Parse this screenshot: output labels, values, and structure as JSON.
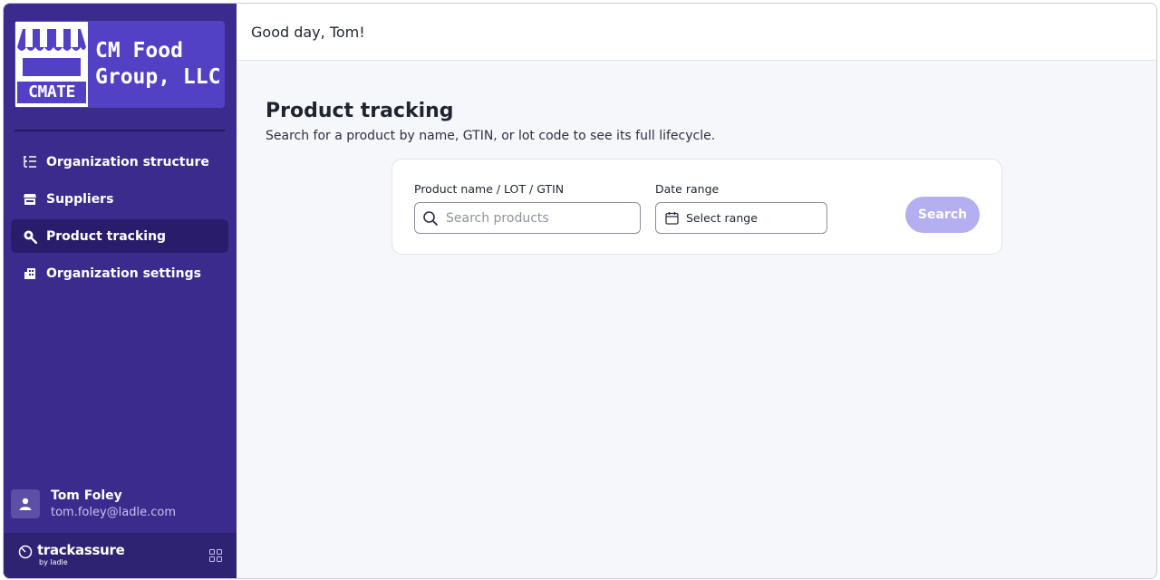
{
  "org": {
    "logo_text": "CMATE",
    "name": "CM Food\nGroup, LLC"
  },
  "sidebar": {
    "items": [
      {
        "label": "Organization structure",
        "icon": "list-tree-icon"
      },
      {
        "label": "Suppliers",
        "icon": "store-icon"
      },
      {
        "label": "Product tracking",
        "icon": "search-icon",
        "active": true
      },
      {
        "label": "Organization settings",
        "icon": "building-icon"
      }
    ]
  },
  "user": {
    "name": "Tom Foley",
    "email": "tom.foley@ladle.com"
  },
  "footer": {
    "brand": "trackassure",
    "brand_sub": "by ladle"
  },
  "header": {
    "greeting": "Good day, Tom!"
  },
  "page": {
    "title": "Product tracking",
    "subtitle": "Search for a product by name, GTIN, or lot code to see its full lifecycle."
  },
  "search": {
    "product_label": "Product name / LOT / GTIN",
    "placeholder": "Search products",
    "value": "",
    "date_label": "Date range",
    "date_placeholder": "Select range",
    "button_label": "Search"
  },
  "colors": {
    "sidebar_bg": "#3a2b8c",
    "brand_bg": "#5241c4",
    "active_item_bg": "#291d6b",
    "button_disabled": "#b3aff0"
  }
}
